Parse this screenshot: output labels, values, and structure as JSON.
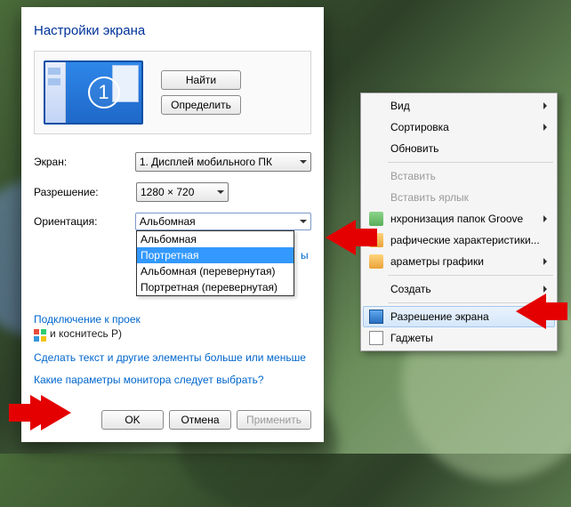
{
  "dialog": {
    "title": "Настройки экрана",
    "find_btn": "Найти",
    "detect_btn": "Определить",
    "monitor_number": "1",
    "screen_label": "Экран:",
    "screen_value": "1. Дисплей мобильного ПК",
    "resolution_label": "Разрешение:",
    "resolution_value": "1280 × 720",
    "orientation_label": "Ориентация:",
    "orientation_value": "Альбомная",
    "orientation_options": [
      "Альбомная",
      "Портретная",
      "Альбомная (перевернутая)",
      "Портретная (перевернутая)"
    ],
    "orientation_selected_index": 1,
    "projector_link": "Подключение к проек",
    "projector_hint": "и коснитесь P)",
    "truncated_tail": "ы",
    "link_textsize": "Сделать текст и другие элементы больше или меньше",
    "link_monitor_params": "Какие параметры монитора следует выбрать?",
    "btn_ok": "OK",
    "btn_cancel": "Отмена",
    "btn_apply": "Применить"
  },
  "ctx": {
    "view": "Вид",
    "sort": "Сортировка",
    "refresh": "Обновить",
    "paste": "Вставить",
    "paste_shortcut": "Вставить ярлык",
    "groove": "нхронизация папок Groove",
    "graphics_props": "рафические характеристики...",
    "graphics_params": "араметры графики",
    "new": "Создать",
    "resolution": "Разрешение экрана",
    "gadgets": "Гаджеты"
  }
}
